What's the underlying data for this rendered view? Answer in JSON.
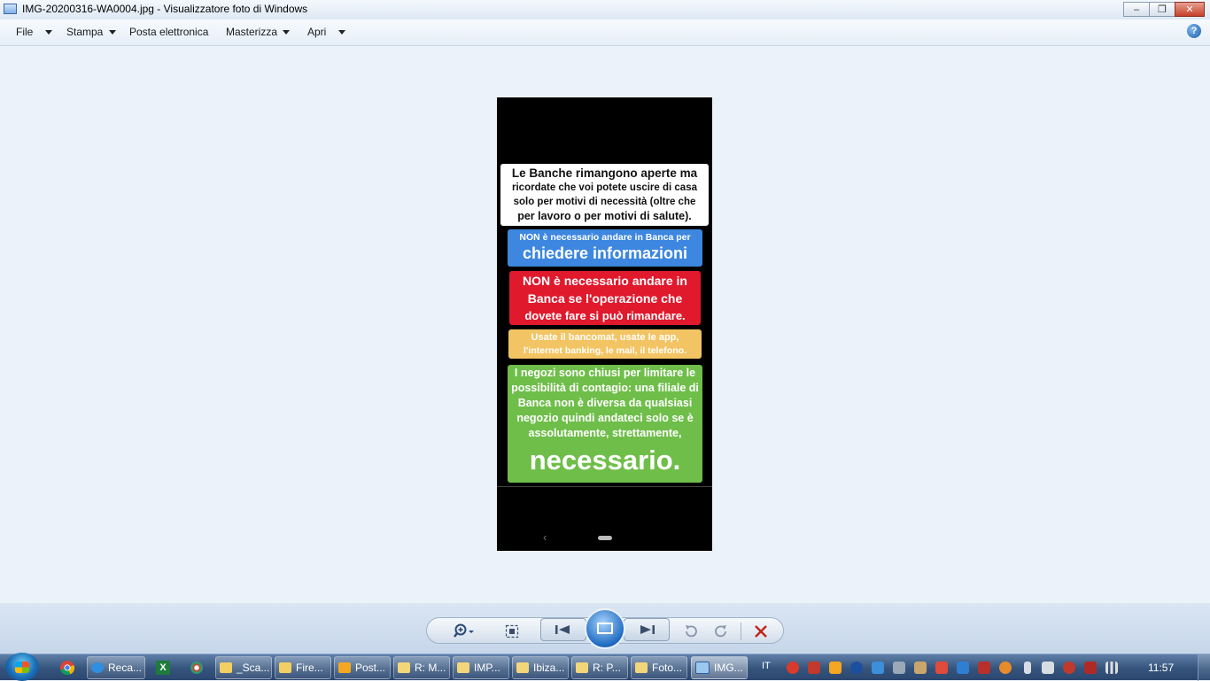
{
  "window": {
    "title": "IMG-20200316-WA0004.jpg - Visualizzatore foto di Windows",
    "controls": {
      "minimize": "–",
      "maximize": "❐",
      "close": "✕"
    }
  },
  "menu": {
    "file": "File",
    "stampa": "Stampa",
    "posta": "Posta elettronica",
    "masterizza": "Masterizza",
    "apri": "Apri",
    "help": "?"
  },
  "photo": {
    "card1": [
      "Le Banche rimangono aperte ma",
      "ricordate che voi potete uscire di casa",
      "solo per motivi di necessità (oltre che",
      "per lavoro o per motivi di salute)."
    ],
    "card2_small": "NON è necessario andare in Banca per",
    "card2_big": "chiedere informazioni",
    "card3": [
      "NON è necessario andare in",
      "Banca se l'operazione che",
      "dovete fare si può rimandare."
    ],
    "card4": [
      "Usate il bancomat, usate le app,",
      "l'internet banking, le mail, il telefono."
    ],
    "card5": [
      "I negozi sono chiusi per limitare le",
      "possibilità di contagio: una filiale di",
      "Banca non è diversa da qualsiasi",
      "negozio quindi andateci solo se è",
      "assolutamente, strettamente,"
    ],
    "card5_big": "necessario.",
    "nav_back": "‹"
  },
  "colors": {
    "blue_card": "#3d87e0",
    "red_card": "#e0192d",
    "yellow_card": "#f3c463",
    "green_card": "#6fbe4a"
  },
  "taskbar": {
    "items": [
      {
        "label": "Reca...",
        "icon": "ie-icon"
      },
      {
        "label": "_Sca...",
        "icon": "folder-icon"
      },
      {
        "label": "Fire...",
        "icon": "folder-icon"
      },
      {
        "label": "Post...",
        "icon": "outlook-icon"
      },
      {
        "label": "R: M...",
        "icon": "mail-icon"
      },
      {
        "label": "IMP...",
        "icon": "mail-icon"
      },
      {
        "label": "Ibiza...",
        "icon": "mail-icon"
      },
      {
        "label": "R: P...",
        "icon": "mail-icon"
      },
      {
        "label": "Foto...",
        "icon": "mail-icon"
      },
      {
        "label": "IMG...",
        "icon": "photo-viewer-icon"
      }
    ],
    "language": "IT",
    "clock": "11:57"
  }
}
